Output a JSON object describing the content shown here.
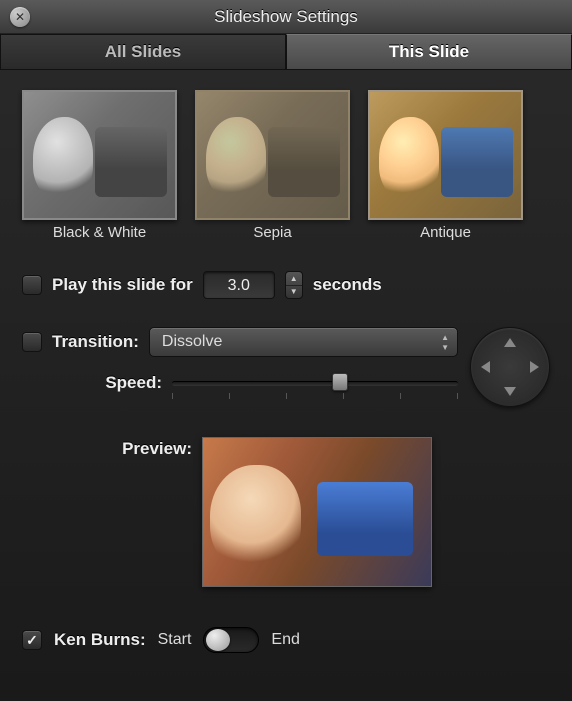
{
  "window": {
    "title": "Slideshow Settings"
  },
  "tabs": {
    "all": "All Slides",
    "this": "This Slide",
    "active": "this"
  },
  "effects": [
    {
      "id": "bw",
      "label": "Black & White"
    },
    {
      "id": "sepia",
      "label": "Sepia"
    },
    {
      "id": "antique",
      "label": "Antique"
    }
  ],
  "play": {
    "checked": false,
    "prefix": "Play this slide for",
    "value": "3.0",
    "suffix": "seconds"
  },
  "transition": {
    "checked": false,
    "label": "Transition:",
    "selected": "Dissolve"
  },
  "speed": {
    "label": "Speed:",
    "value": 0.56
  },
  "preview": {
    "label": "Preview:"
  },
  "kenburns": {
    "checked": true,
    "label": "Ken Burns:",
    "start": "Start",
    "end": "End",
    "position": "start"
  }
}
